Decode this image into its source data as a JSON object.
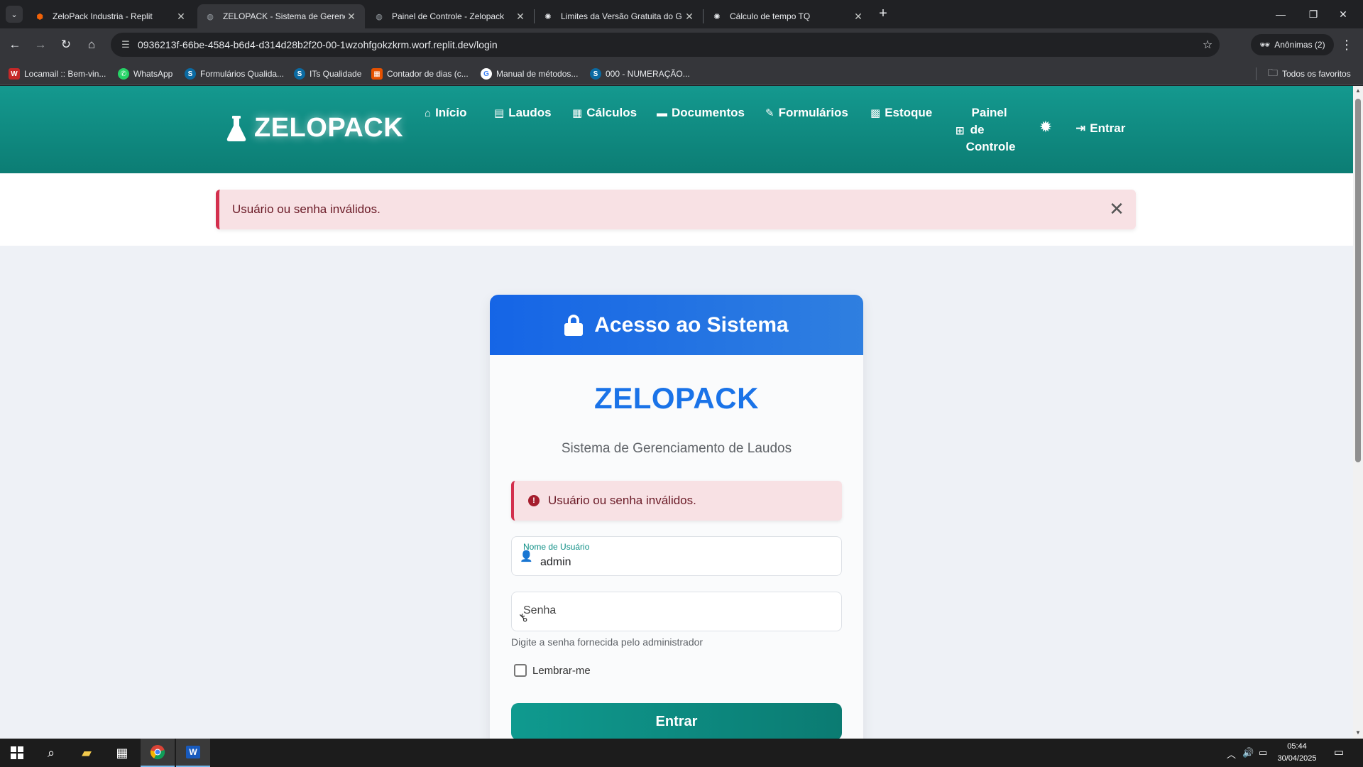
{
  "browser": {
    "tabs": [
      {
        "title": "ZeloPack Industria - Replit",
        "favicon": "replit-icon",
        "active": false
      },
      {
        "title": "ZELOPACK - Sistema de Gerenc",
        "favicon": "globe-icon",
        "active": true
      },
      {
        "title": "Painel de Controle - Zelopack",
        "favicon": "globe-icon",
        "active": false
      },
      {
        "title": "Limites da Versão Gratuita do G",
        "favicon": "openai-icon",
        "active": false
      },
      {
        "title": "Cálculo de tempo TQ",
        "favicon": "openai-icon",
        "active": false
      }
    ],
    "url": "0936213f-66be-4584-b6d4-d314d28b2f20-00-1wzohfgokzkrm.worf.replit.dev/login",
    "incognito_label": "Anônimas (2)",
    "bookmarks": [
      {
        "label": "Locamail :: Bem-vin...",
        "icon": "W",
        "color": "#c62828"
      },
      {
        "label": "WhatsApp",
        "icon": "✆",
        "color": "#25d366"
      },
      {
        "label": "Formulários Qualida...",
        "icon": "S",
        "color": "#0b6aa2"
      },
      {
        "label": "ITs Qualidade",
        "icon": "S",
        "color": "#0b6aa2"
      },
      {
        "label": "Contador de dias (c...",
        "icon": "▦",
        "color": "#e65100"
      },
      {
        "label": "Manual de métodos...",
        "icon": "G",
        "color": "#4285f4"
      },
      {
        "label": "000 - NUMERAÇÃO...",
        "icon": "S",
        "color": "#0b6aa2"
      }
    ],
    "all_bookmarks_label": "Todos os favoritos"
  },
  "site": {
    "brand": "ZELOPACK",
    "nav": [
      {
        "label": "Início",
        "icon": "home-icon",
        "glyph": "⌂"
      },
      {
        "label": "Laudos",
        "icon": "file-icon",
        "glyph": "▤"
      },
      {
        "label": "Cálculos",
        "icon": "calculator-icon",
        "glyph": "▦"
      },
      {
        "label": "Documentos",
        "icon": "folder-icon",
        "glyph": "▬"
      },
      {
        "label": "Formulários",
        "icon": "edit-icon",
        "glyph": "✎"
      },
      {
        "label": "Estoque",
        "icon": "boxes-icon",
        "glyph": "▩"
      }
    ],
    "painel_lines": [
      "Painel",
      "de",
      "Controle"
    ],
    "login_label": "Entrar"
  },
  "flash": {
    "message": "Usuário ou senha inválidos."
  },
  "login_card": {
    "header_title": "Acesso ao Sistema",
    "brand": "ZELOPACK",
    "subtitle": "Sistema de Gerenciamento de Laudos",
    "error_message": "Usuário ou senha inválidos.",
    "username_label": "Nome de Usuário",
    "username_value": "admin",
    "password_label": "Senha",
    "password_hint": "Digite a senha fornecida pelo administrador",
    "remember_label": "Lembrar-me",
    "submit_label": "Entrar"
  },
  "taskbar": {
    "time": "05:44",
    "date": "30/04/2025"
  },
  "colors": {
    "header_teal": "#0e8c82",
    "card_blue": "#1a73e8",
    "alert_red": "#d32f4d",
    "alert_bg": "#f8e1e4"
  }
}
